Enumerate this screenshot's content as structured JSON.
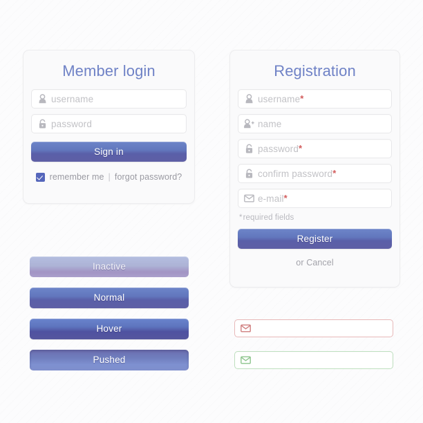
{
  "login": {
    "title": "Member login",
    "fields": [
      {
        "icon": "user-icon",
        "placeholder": "username"
      },
      {
        "icon": "lock-icon",
        "placeholder": "password"
      }
    ],
    "submit_label": "Sign in",
    "remember_label": "remember me",
    "separator": "|",
    "forgot_label": "forgot password?",
    "checkbox_checked": true
  },
  "registration": {
    "title": "Registration",
    "fields": [
      {
        "icon": "user-icon",
        "placeholder": "username",
        "required": true
      },
      {
        "icon": "user-add-icon",
        "placeholder": "name",
        "required": false
      },
      {
        "icon": "lock-icon",
        "placeholder": "password",
        "required": true
      },
      {
        "icon": "lock-icon",
        "placeholder": "confirm password",
        "required": true
      },
      {
        "icon": "mail-icon",
        "placeholder": "e-mail",
        "required": true
      }
    ],
    "required_note": "required fields",
    "required_marker": "*",
    "submit_label": "Register",
    "cancel_prefix": "or ",
    "cancel_label": "Cancel"
  },
  "button_states": [
    {
      "label": "Inactive",
      "state": "inactive"
    },
    {
      "label": "Normal",
      "state": "normal"
    },
    {
      "label": "Hover",
      "state": "hover"
    },
    {
      "label": "Pushed",
      "state": "pushed"
    }
  ],
  "validation_fields": [
    {
      "icon": "mail-icon",
      "state": "error",
      "value": ""
    },
    {
      "icon": "mail-icon",
      "state": "success",
      "value": ""
    }
  ],
  "colors": {
    "title_blue": "#6f82c6",
    "button_top": "#6d85c9",
    "button_bottom": "#5e5fa5",
    "inactive_top": "#b4bee0",
    "placeholder_gray": "#c2c2c6",
    "required_red": "#d25b5b",
    "error_border": "#e8b9b9",
    "error_icon": "#cf7d7d",
    "success_border": "#bedfbe",
    "success_icon": "#8cc48c",
    "panel_bg": "#fafafb",
    "page_bg": "#fcfcfd",
    "checkbox_blue": "#5566bb"
  }
}
